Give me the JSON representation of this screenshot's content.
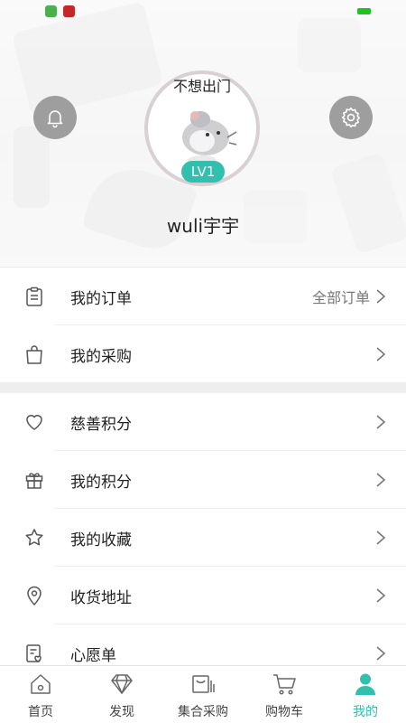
{
  "profile": {
    "avatar_caption": "不想出门",
    "level": "LV1",
    "username": "wuli宇宇"
  },
  "menu_group_1": [
    {
      "label": "我的订单",
      "extra": "全部订单",
      "icon": "clipboard-icon"
    },
    {
      "label": "我的采购",
      "extra": "",
      "icon": "shopping-bag-icon"
    }
  ],
  "menu_group_2": [
    {
      "label": "慈善积分",
      "icon": "heart-icon"
    },
    {
      "label": "我的积分",
      "icon": "gift-icon"
    },
    {
      "label": "我的收藏",
      "icon": "star-icon"
    },
    {
      "label": "收货地址",
      "icon": "location-pin-icon"
    },
    {
      "label": "心愿单",
      "icon": "wishlist-icon"
    }
  ],
  "tabbar": [
    {
      "label": "首页",
      "icon": "home-icon",
      "active": false
    },
    {
      "label": "发现",
      "icon": "diamond-icon",
      "active": false
    },
    {
      "label": "集合采购",
      "icon": "group-purchase-icon",
      "active": false
    },
    {
      "label": "购物车",
      "icon": "cart-icon",
      "active": false
    },
    {
      "label": "我的",
      "icon": "person-icon",
      "active": true
    }
  ],
  "colors": {
    "accent": "#33bfad",
    "icon_button_bg": "#9e9e9e"
  }
}
